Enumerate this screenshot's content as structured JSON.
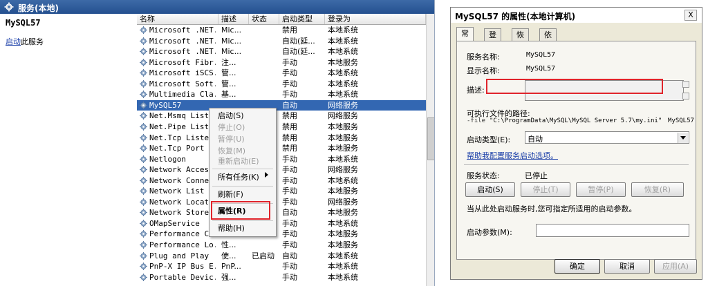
{
  "console": {
    "title": "服务(本地)",
    "selected_service": "MySQL57",
    "start_link": "启动",
    "start_link_suffix": "此服务",
    "columns": [
      "名称",
      "描述",
      "状态",
      "启动类型",
      "登录为"
    ],
    "rows": [
      {
        "name": "Microsoft .NET...",
        "desc": "Mic...",
        "status": "",
        "type": "禁用",
        "logon": "本地系统"
      },
      {
        "name": "Microsoft .NET...",
        "desc": "Mic...",
        "status": "",
        "type": "自动(延...",
        "logon": "本地系统"
      },
      {
        "name": "Microsoft .NET...",
        "desc": "Mic...",
        "status": "",
        "type": "自动(延...",
        "logon": "本地系统"
      },
      {
        "name": "Microsoft Fibr...",
        "desc": "注...",
        "status": "",
        "type": "手动",
        "logon": "本地服务"
      },
      {
        "name": "Microsoft iSCS...",
        "desc": "管...",
        "status": "",
        "type": "手动",
        "logon": "本地系统"
      },
      {
        "name": "Microsoft Soft...",
        "desc": "管...",
        "status": "",
        "type": "手动",
        "logon": "本地系统"
      },
      {
        "name": "Multimedia Cla...",
        "desc": "基...",
        "status": "",
        "type": "手动",
        "logon": "本地系统"
      },
      {
        "name": "MySQL57",
        "desc": "",
        "status": "",
        "type": "自动",
        "logon": "网络服务",
        "selected": true
      },
      {
        "name": "Net.Msmq Liste...",
        "desc": "",
        "status": "",
        "type": "禁用",
        "logon": "网络服务"
      },
      {
        "name": "Net.Pipe Liste...",
        "desc": "",
        "status": "",
        "type": "禁用",
        "logon": "本地服务"
      },
      {
        "name": "Net.Tcp Listen...",
        "desc": "",
        "status": "",
        "type": "禁用",
        "logon": "本地服务"
      },
      {
        "name": "Net.Tcp Port S...",
        "desc": "",
        "status": "",
        "type": "禁用",
        "logon": "本地服务"
      },
      {
        "name": "Netlogon",
        "desc": "",
        "status": "",
        "type": "手动",
        "logon": "本地系统"
      },
      {
        "name": "Network Access...",
        "desc": "",
        "status": "",
        "type": "手动",
        "logon": "网络服务"
      },
      {
        "name": "Network Connec...",
        "desc": "",
        "status": "",
        "type": "手动",
        "logon": "本地系统"
      },
      {
        "name": "Network List S...",
        "desc": "",
        "status": "",
        "type": "手动",
        "logon": "本地服务"
      },
      {
        "name": "Network Locati...",
        "desc": "",
        "status": "",
        "type": "手动",
        "logon": "网络服务"
      },
      {
        "name": "Network Store ...",
        "desc": "",
        "status": "",
        "type": "自动",
        "logon": "本地服务"
      },
      {
        "name": "OMapService",
        "desc": "",
        "status": "",
        "type": "手动",
        "logon": "本地系统"
      },
      {
        "name": "Performance Co...",
        "desc": "",
        "status": "",
        "type": "手动",
        "logon": "本地服务"
      },
      {
        "name": "Performance Lo...",
        "desc": "性...",
        "status": "",
        "type": "手动",
        "logon": "本地服务"
      },
      {
        "name": "Plug and Play",
        "desc": "使...",
        "status": "已启动",
        "type": "自动",
        "logon": "本地系统"
      },
      {
        "name": "PnP-X IP Bus E...",
        "desc": "PnP...",
        "status": "",
        "type": "手动",
        "logon": "本地系统"
      },
      {
        "name": "Portable Devic...",
        "desc": "强...",
        "status": "",
        "type": "手动",
        "logon": "本地系统"
      }
    ]
  },
  "context_menu": {
    "items": [
      {
        "label": "启动(S)",
        "disabled": false
      },
      {
        "label": "停止(O)",
        "disabled": true
      },
      {
        "label": "暂停(U)",
        "disabled": true
      },
      {
        "label": "恢复(M)",
        "disabled": true
      },
      {
        "label": "重新启动(E)",
        "disabled": true
      },
      {
        "label": "所有任务(K)",
        "disabled": false
      },
      {
        "label": "刷新(F)",
        "disabled": false
      },
      {
        "label": "属性(R)",
        "disabled": false
      },
      {
        "label": "帮助(H)",
        "disabled": false
      }
    ]
  },
  "dialog": {
    "title": "MySQL57 的属性(本地计算机)",
    "close": "X",
    "tabs": [
      "常规",
      "登录",
      "恢复",
      "依存关系"
    ],
    "service_name_label": "服务名称:",
    "service_name": "MySQL57",
    "display_name_label": "显示名称:",
    "display_name": "MySQL57",
    "description_label": "描述:",
    "exe_path_label": "可执行文件的路径:",
    "exe_path_prefix": "-file",
    "exe_path": "\"C:\\ProgramData\\MySQL\\MySQL Server 5.7\\my.ini\"",
    "exe_path_suffix": "MySQL57",
    "startup_type_label": "启动类型(E):",
    "startup_type": "自动",
    "help_link": "帮助我配置服务启动选项。",
    "status_label": "服务状态:",
    "status_value": "已停止",
    "buttons": {
      "start": "启动(S)",
      "stop": "停止(T)",
      "pause": "暂停(P)",
      "resume": "恢复(R)"
    },
    "hint": "当从此处启动服务时,您可指定所适用的启动参数。",
    "params_label": "启动参数(M):",
    "ok": "确定",
    "cancel": "取消",
    "apply": "应用(A)"
  }
}
